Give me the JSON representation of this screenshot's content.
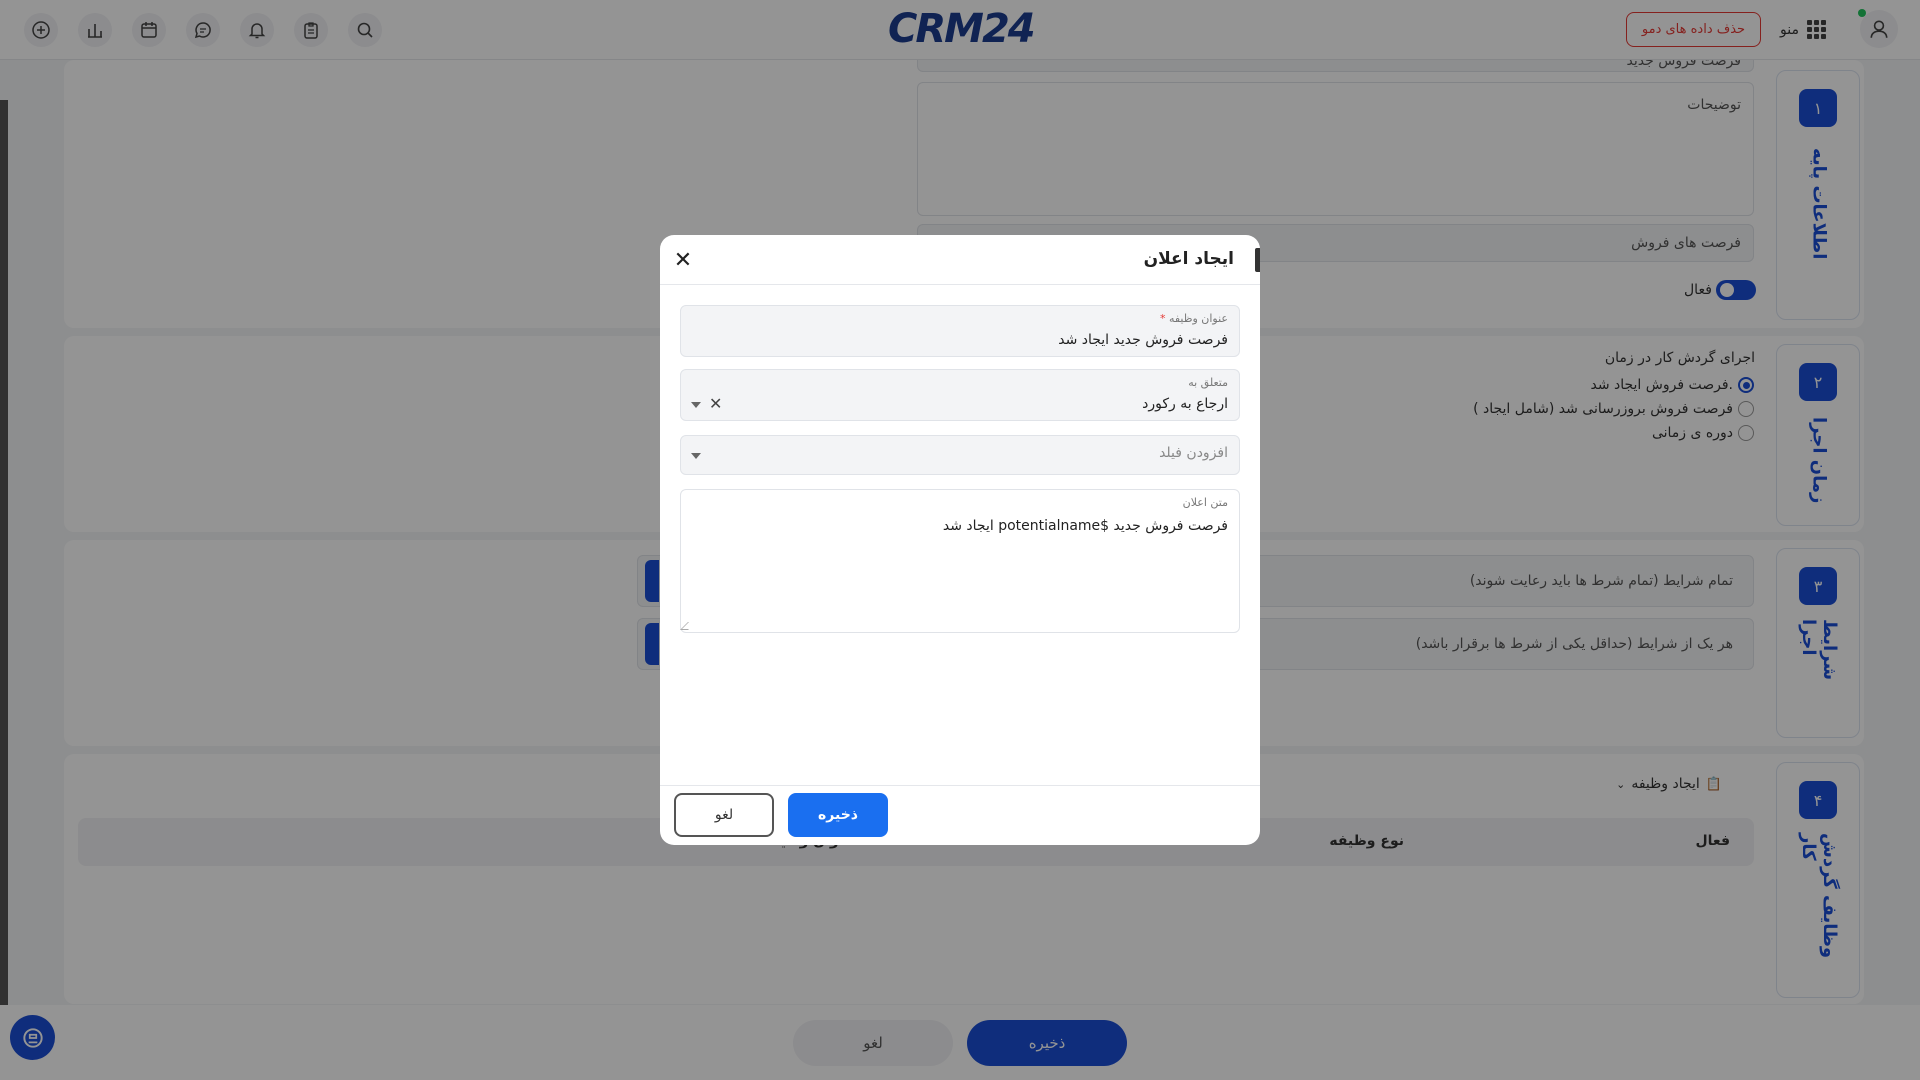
{
  "topbar": {
    "logo": "CRM24",
    "demo_delete": "حذف داده های دمو",
    "menu_label": "منو",
    "icons": [
      "add-icon",
      "chart-icon",
      "calendar-icon",
      "chat-icon",
      "bell-icon",
      "clipboard-icon",
      "search-icon",
      "user-icon",
      "apps-grid-icon"
    ]
  },
  "background": {
    "step1": {
      "num": "۱",
      "title": "اطلاعات پایه",
      "name_value": "فرصت فروش جدید",
      "description_placeholder": "توضیحات",
      "module_value": "فرصت های فروش",
      "active_label": "فعال"
    },
    "step2": {
      "num": "۲",
      "title": "زمان اجرا",
      "heading": "اجرای گردش کار در زمان",
      "options": [
        "فرصت فروش ایجاد شد.",
        "فرصت فروش بروزرسانی شد (شامل ایجاد )",
        "دوره ی زمانی"
      ]
    },
    "step3": {
      "num": "۳",
      "title": "شرایط اجرا",
      "all_conditions": "تمام شرایط (تمام شرط ها باید رعایت شوند)",
      "any_conditions": "هر یک از شرایط (حداقل یکی از شرط ها برقرار باشد)"
    },
    "step4": {
      "num": "۴",
      "title": "وظایف گردش کار",
      "create_task": "ایجاد وظیفه",
      "columns": [
        "فعال",
        "نوع وظیفه",
        "عنوان وظیفه"
      ]
    },
    "save_label": "ذخیره",
    "cancel_label": "لغو"
  },
  "modal": {
    "title": "ایجاد اعلان",
    "task_title_label": "عنوان وظیفه",
    "task_title_required": "*",
    "task_title_value": "فرصت فروش جدید ایجاد شد",
    "related_label": "متعلق به",
    "related_value": "ارجاع به رکورد",
    "add_field_placeholder": "افزودن فیلد",
    "message_label": "متن اعلان",
    "message_value": "فرصت فروش جدید  $potentialname ایجاد شد",
    "save_label": "ذخیره",
    "cancel_label": "لغو"
  },
  "colors": {
    "primary": "#1a4fd6",
    "danger": "#e53935",
    "online": "#22c55e"
  }
}
